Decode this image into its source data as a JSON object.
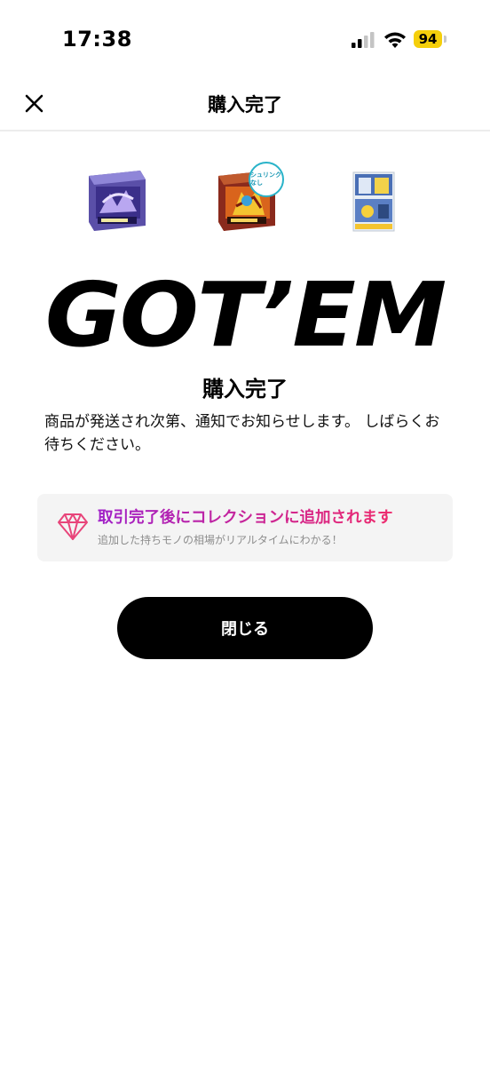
{
  "status_bar": {
    "time": "17:38",
    "battery_level": "94",
    "icons": [
      "signal-icon",
      "wifi-icon",
      "battery-icon"
    ]
  },
  "header": {
    "title": "購入完了",
    "close_icon": "close-icon"
  },
  "products": [
    {
      "name": "product-box-1",
      "badge": ""
    },
    {
      "name": "product-box-2",
      "badge": "シュリンク なし"
    },
    {
      "name": "product-box-3",
      "badge": ""
    }
  ],
  "main": {
    "logo_text": "GOT’EM",
    "heading": "購入完了",
    "message": "商品が発送され次第、通知でお知らせします。 しばらくお待ちください。"
  },
  "collection_banner": {
    "icon": "diamond-icon",
    "title": "取引完了後にコレクションに追加されます",
    "subtitle": "追加した持ちモノの相場がリアルタイムにわかる！",
    "title_gradient": [
      "#a020c8",
      "#ee2a6c"
    ],
    "icon_color": "#e8457a"
  },
  "close_button": {
    "label": "閉じる"
  }
}
